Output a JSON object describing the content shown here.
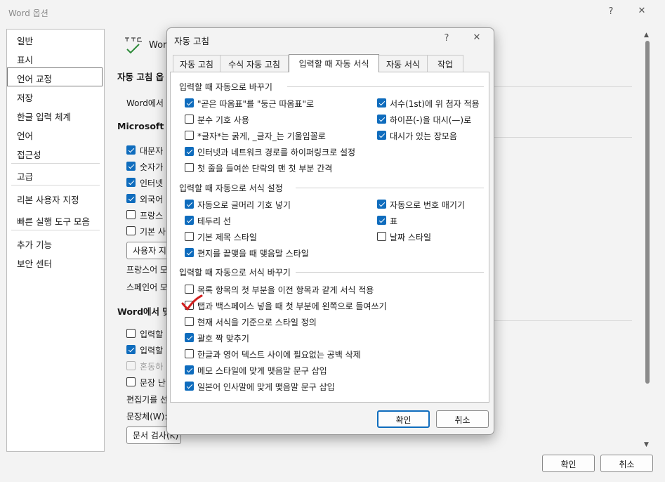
{
  "word_options": {
    "title": "Word 옵션",
    "help": "?",
    "close": "✕",
    "nav": [
      "일반",
      "표시",
      "언어 교정",
      "저장",
      "한글 입력 체계",
      "언어",
      "접근성",
      "고급",
      "리본 사용자 지정",
      "빠른 실행 도구 모음",
      "추가 기능",
      "보안 센터"
    ],
    "selected_nav": "언어 교정",
    "bg": {
      "word_label": "Wor",
      "autocorrect_head": "자동 고침 옵",
      "word_in": "Word에서",
      "ms_office_head": "Microsoft Of",
      "opt1": "대문자",
      "opt2": "숫자가",
      "opt3": "인터넷",
      "opt4": "외국어",
      "opt5": "프랑스",
      "opt6": "기본 사",
      "user_btn": "사용자 지",
      "french": "프랑스어 모",
      "spanish": "스페인어 모",
      "word_when_head": "Word에서 맞",
      "w1": "입력할",
      "w2": "입력할",
      "w3": "혼동하",
      "w4": "문장 난",
      "editor": "편집기를 선",
      "style": "문장체(W):",
      "doc_check_btn": "문서 검사(K)"
    },
    "ok": "확인",
    "cancel": "취소"
  },
  "dialog": {
    "title": "자동 고침",
    "help": "?",
    "close": "✕",
    "tabs": [
      "자동 고침",
      "수식 자동 고침",
      "입력할 때 자동 서식",
      "자동 서식",
      "작업"
    ],
    "active_tab": "입력할 때 자동 서식",
    "section1": "입력할 때 자동으로 바꾸기",
    "s1_left": [
      {
        "label": "\"곧은 따옴표\"를 \"둥근 따옴표\"로",
        "checked": true
      },
      {
        "label": "분수 기호 사용",
        "checked": false
      },
      {
        "label": "*글자*는 굵게, _글자_는 기울임꼴로",
        "checked": false
      },
      {
        "label": "인터넷과 네트워크 경로를 하이퍼링크로 설정",
        "checked": true
      },
      {
        "label": "첫 줄을 들여쓴 단락의 맨 첫 부분 간격",
        "checked": false
      }
    ],
    "s1_right": [
      {
        "label": "서수(1st)에 위 첨자 적용",
        "checked": true
      },
      {
        "label": "하이픈(-)을 대시(—)로",
        "checked": true
      },
      {
        "label": "대시가 있는 장모음",
        "checked": true
      }
    ],
    "section2": "입력할 때 자동으로 서식 설정",
    "s2_left": [
      {
        "label": "자동으로 글머리 기호 넣기",
        "checked": true
      },
      {
        "label": "테두리 선",
        "checked": true
      },
      {
        "label": "기본 제목 스타일",
        "checked": false
      },
      {
        "label": "편지를 끝맺을 때 맺음말 스타일",
        "checked": true
      }
    ],
    "s2_right": [
      {
        "label": "자동으로 번호 매기기",
        "checked": true
      },
      {
        "label": "표",
        "checked": true
      },
      {
        "label": "날짜 스타일",
        "checked": false
      }
    ],
    "section3": "입력할 때 자동으로 서식 바꾸기",
    "s3": [
      {
        "label": "목록 항목의 첫 부분을 이전 항목과 같게 서식 적용",
        "checked": false
      },
      {
        "label": "탭과 백스페이스 넣을 때 첫 부분에 왼쪽으로 들여쓰기",
        "checked": false
      },
      {
        "label": "현재 서식을 기준으로 스타일 정의",
        "checked": false
      },
      {
        "label": "괄호 짝 맞추기",
        "checked": true
      },
      {
        "label": "한글과 영어 텍스트 사이에 필요없는 공백 삭제",
        "checked": false
      },
      {
        "label": "메모 스타일에 맞게 맺음말 문구 삽입",
        "checked": true
      },
      {
        "label": "일본어 인사말에 맞게 맺음말 문구 삽입",
        "checked": true
      }
    ],
    "ok": "확인",
    "cancel": "취소",
    "accent": "#0f6cbd",
    "annotation_color": "#d11f1f"
  }
}
